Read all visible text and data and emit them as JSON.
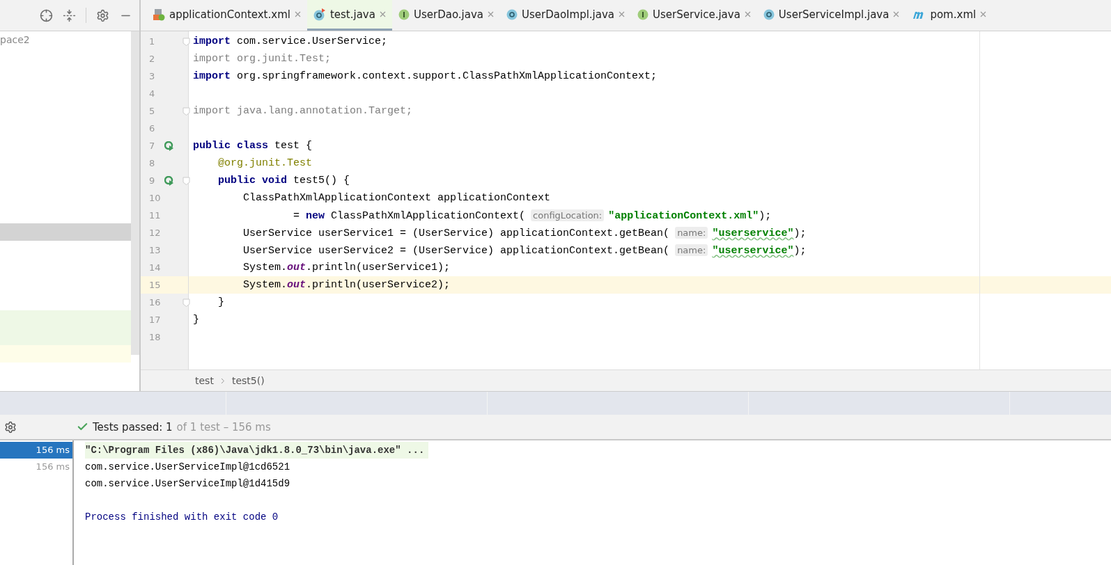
{
  "project_panel": {
    "root_label": "pace2",
    "rows": [
      {
        "kind": "selected"
      },
      {
        "kind": "added"
      },
      {
        "kind": "added"
      },
      {
        "kind": "current"
      }
    ]
  },
  "tabs": [
    {
      "label": "applicationContext.xml",
      "kind": "xml",
      "selected": false
    },
    {
      "label": "test.java",
      "kind": "test-class",
      "selected": true
    },
    {
      "label": "UserDao.java",
      "kind": "interface",
      "selected": false
    },
    {
      "label": "UserDaoImpl.java",
      "kind": "class",
      "selected": false
    },
    {
      "label": "UserService.java",
      "kind": "interface",
      "selected": false
    },
    {
      "label": "UserServiceImpl.java",
      "kind": "class",
      "selected": false
    },
    {
      "label": "pom.xml",
      "kind": "maven",
      "selected": false
    }
  ],
  "editor": {
    "lines": [
      {
        "number": "1",
        "fold": true,
        "segments": [
          {
            "kind": "keyword",
            "text": "import"
          },
          {
            "kind": "plain",
            "text": " com.service.UserService;"
          }
        ]
      },
      {
        "number": "2",
        "segments": [
          {
            "kind": "unused",
            "text": "import org.junit.Test;"
          }
        ]
      },
      {
        "number": "3",
        "segments": [
          {
            "kind": "keyword",
            "text": "import"
          },
          {
            "kind": "plain",
            "text": " org.springframework.context.support.ClassPathXmlApplicationContext;"
          }
        ]
      },
      {
        "number": "4"
      },
      {
        "number": "5",
        "fold": true,
        "segments": [
          {
            "kind": "unused",
            "text": "import java.lang.annotation.Target;"
          }
        ]
      },
      {
        "number": "6"
      },
      {
        "number": "7",
        "run": true,
        "segments": [
          {
            "kind": "keyword",
            "text": "public class"
          },
          {
            "kind": "plain",
            "text": " test {"
          }
        ]
      },
      {
        "number": "8",
        "segments": [
          {
            "kind": "annotation",
            "text": "    @org.junit."
          },
          {
            "kind": "annotation-name",
            "text": "Test"
          }
        ]
      },
      {
        "number": "9",
        "run": true,
        "fold": true,
        "segments": [
          {
            "kind": "keyword",
            "text": "    public void"
          },
          {
            "kind": "plain",
            "text": " test5() {"
          }
        ]
      },
      {
        "number": "10",
        "segments": [
          {
            "kind": "plain",
            "text": "        ClassPathXmlApplicationContext applicationContext"
          }
        ]
      },
      {
        "number": "11",
        "segments": [
          {
            "kind": "plain",
            "text": "                = "
          },
          {
            "kind": "keyword",
            "text": "new"
          },
          {
            "kind": "plain",
            "text": " ClassPathXmlApplicationContext("
          },
          {
            "kind": "hint",
            "text": "configLocation:"
          },
          {
            "kind": "string",
            "text": "\"applicationContext.xml\""
          },
          {
            "kind": "plain",
            "text": ");"
          }
        ]
      },
      {
        "number": "12",
        "segments": [
          {
            "kind": "plain",
            "text": "        UserService userService1 = (UserService) applicationContext.getBean("
          },
          {
            "kind": "hint",
            "text": "name:"
          },
          {
            "kind": "string-typo",
            "text": "\"userservice\""
          },
          {
            "kind": "plain",
            "text": ");"
          }
        ]
      },
      {
        "number": "13",
        "segments": [
          {
            "kind": "plain",
            "text": "        UserService userService2 = (UserService) applicationContext.getBean("
          },
          {
            "kind": "hint",
            "text": "name:"
          },
          {
            "kind": "string-typo",
            "text": "\"userservice\""
          },
          {
            "kind": "plain",
            "text": ");"
          }
        ]
      },
      {
        "number": "14",
        "segments": [
          {
            "kind": "plain",
            "text": "        System."
          },
          {
            "kind": "static",
            "text": "out"
          },
          {
            "kind": "plain",
            "text": ".println(userService1);"
          }
        ]
      },
      {
        "number": "15",
        "current": true,
        "segments": [
          {
            "kind": "plain",
            "text": "        System."
          },
          {
            "kind": "static",
            "text": "out"
          },
          {
            "kind": "plain",
            "text": ".println(userService2);"
          }
        ]
      },
      {
        "number": "16",
        "fold": true,
        "segments": [
          {
            "kind": "plain",
            "text": "    }"
          }
        ]
      },
      {
        "number": "17",
        "segments": [
          {
            "kind": "plain",
            "text": "}"
          }
        ]
      },
      {
        "number": "18"
      }
    ],
    "breadcrumbs": [
      "test",
      "test5()"
    ]
  },
  "run_panel": {
    "status": "Tests passed: 1",
    "detail": "of 1 test – 156 ms",
    "tests": [
      {
        "time": "156 ms",
        "selected": true
      },
      {
        "time": "156 ms",
        "selected": false
      }
    ],
    "console": [
      {
        "kind": "command",
        "text": "\"C:\\Program Files (x86)\\Java\\jdk1.8.0_73\\bin\\java.exe\" ..."
      },
      {
        "kind": "output",
        "text": "com.service.UserServiceImpl@1cd6521"
      },
      {
        "kind": "output",
        "text": "com.service.UserServiceImpl@1d415d9"
      },
      {
        "kind": "exit",
        "text": "Process finished with exit code 0"
      }
    ]
  }
}
